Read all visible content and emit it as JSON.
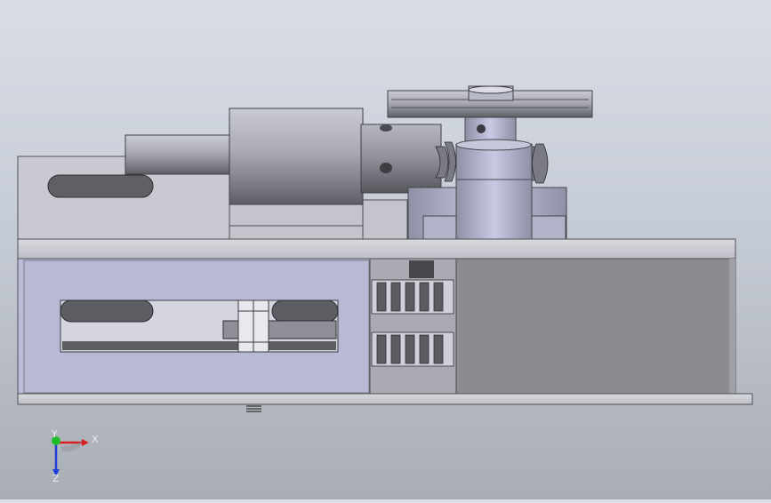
{
  "viewport": {
    "background_top": "#d9dde6",
    "background_bottom": "#a9adb4",
    "model": {
      "colors": {
        "base_plate": "#cfd0d6",
        "side_housing": "#b9bbd6",
        "dark_housing": "#8a8b8f",
        "shaft": "#9a9ba4",
        "pulley": "#b8b8c6",
        "gear_teeth": "#6e6f75"
      }
    }
  },
  "triad": {
    "x_label": "X",
    "y_label": "Y",
    "z_label": "Z",
    "x_color": "#d81e1e",
    "y_color": "#1fbf2b",
    "z_color": "#1f3fd8"
  }
}
